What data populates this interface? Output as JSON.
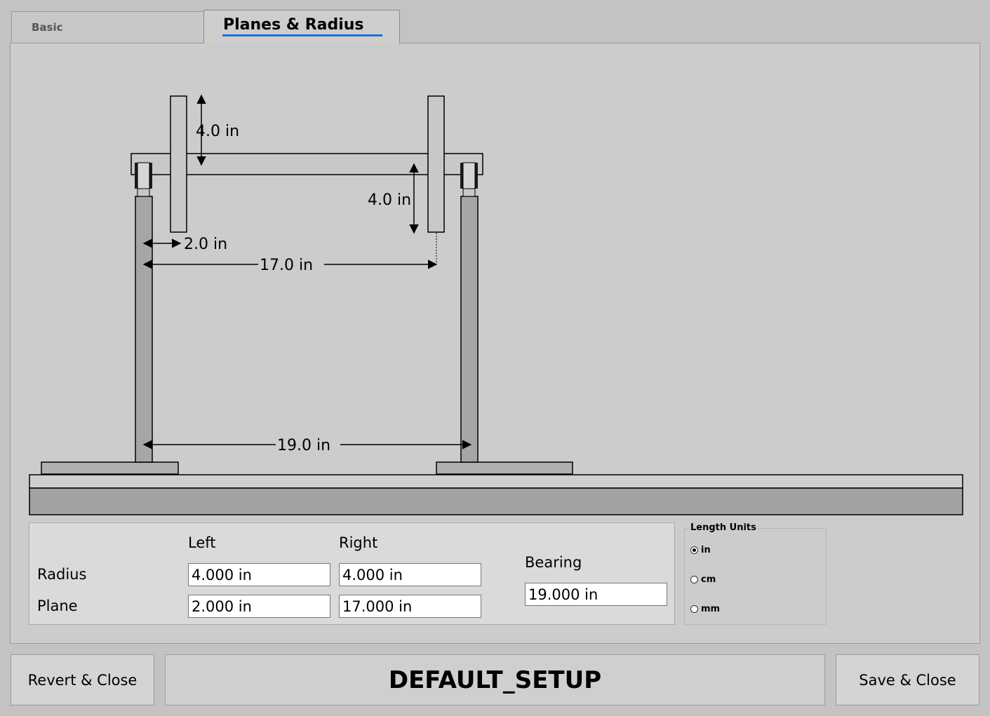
{
  "tabs": {
    "basic": "Basic",
    "planes_radius": "Planes & Radius"
  },
  "diagram": {
    "left_radius_label": "4.0 in",
    "right_radius_label": "4.0 in",
    "left_plane_label": "2.0 in",
    "right_plane_label": "17.0 in",
    "bearing_label": "19.0 in"
  },
  "inputs": {
    "col_left": "Left",
    "col_right": "Right",
    "row_radius": "Radius",
    "row_plane": "Plane",
    "radius_left": "4.000 in",
    "radius_right": "4.000 in",
    "plane_left": "2.000 in",
    "plane_right": "17.000 in",
    "bearing_label": "Bearing",
    "bearing_value": "19.000 in"
  },
  "units": {
    "title": "Length Units",
    "options": [
      "in",
      "cm",
      "mm"
    ],
    "selected": "in"
  },
  "footer": {
    "revert_label": "Revert & Close",
    "setup_name": "DEFAULT_SETUP",
    "save_label": "Save & Close"
  }
}
